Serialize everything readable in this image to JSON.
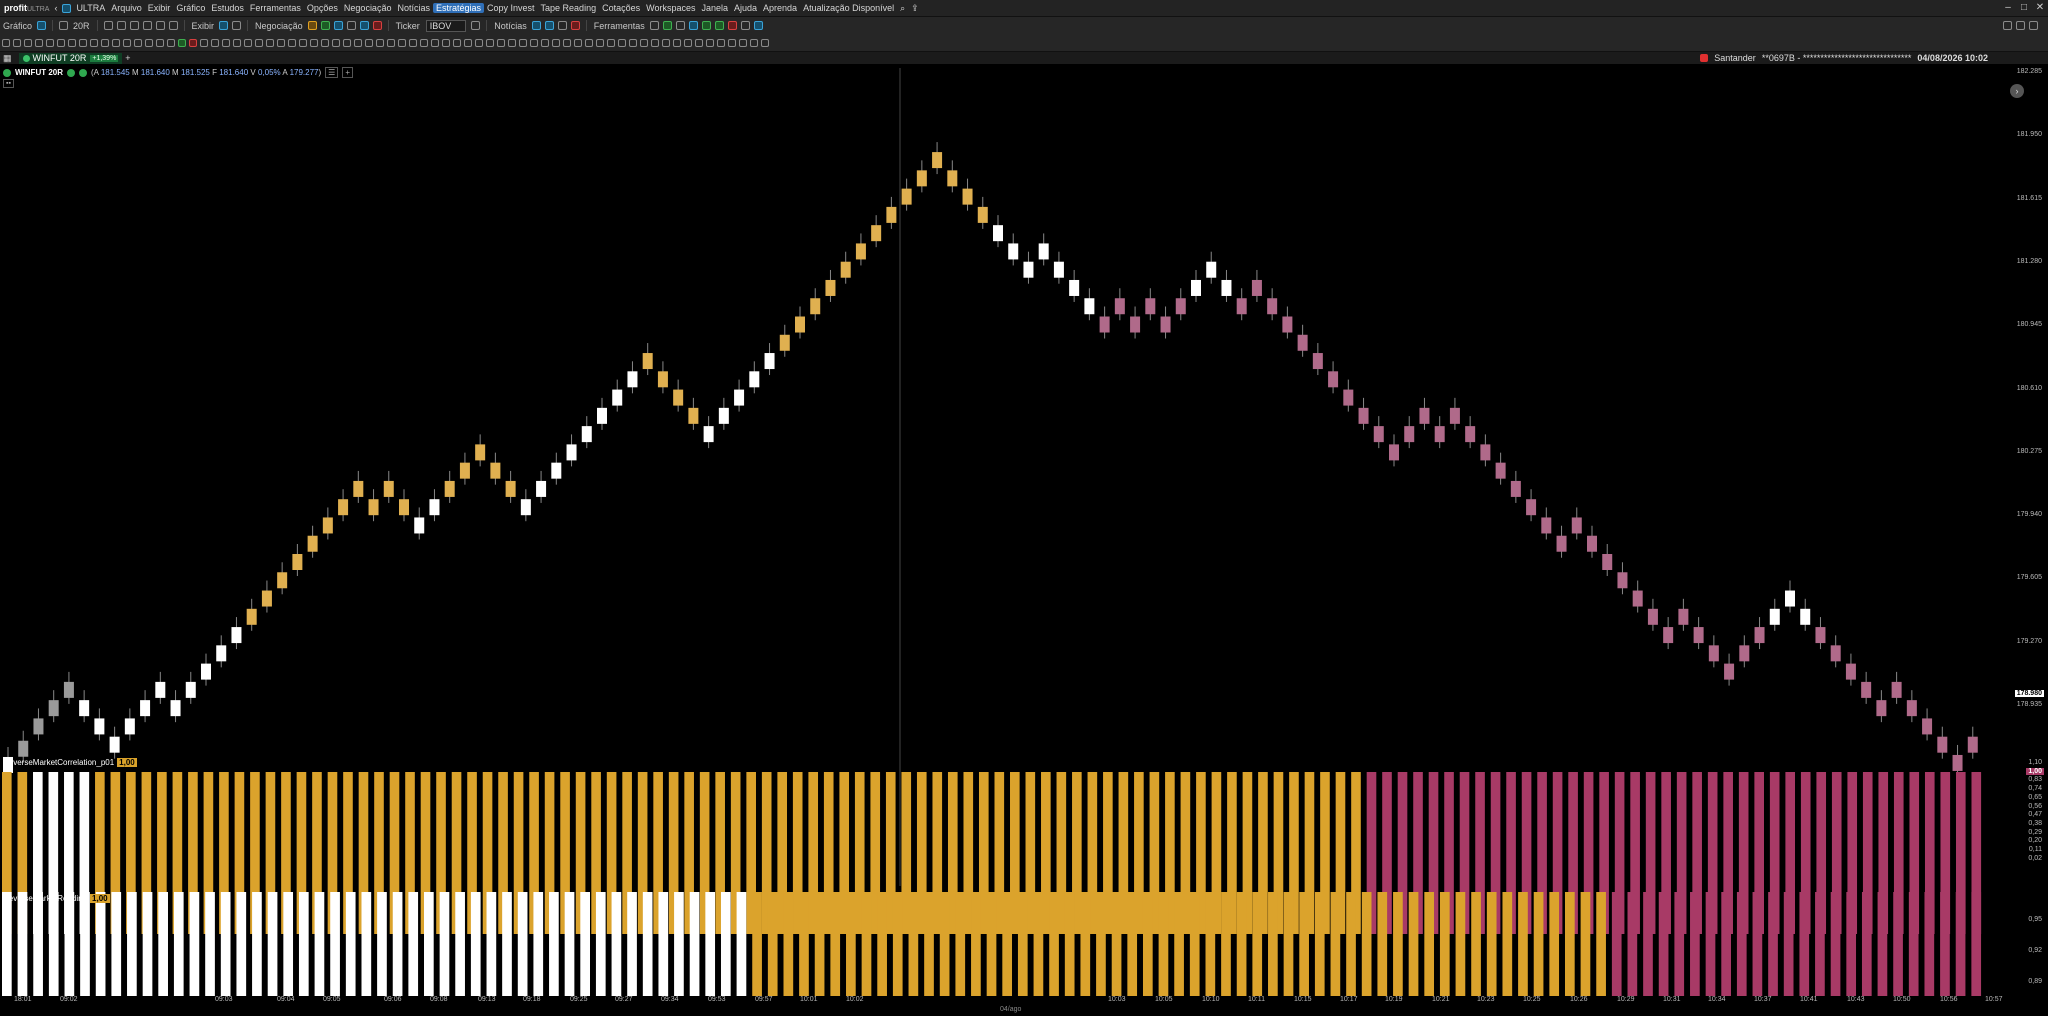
{
  "app": {
    "name": "profit",
    "edition": "ULTRA",
    "badge": "ULTRA"
  },
  "menu": [
    "Arquivo",
    "Exibir",
    "Gráfico",
    "Estudos",
    "Ferramentas",
    "Opções",
    "Negociação",
    "Notícias",
    "Estratégias",
    "Copy Invest",
    "Tape Reading",
    "Cotações",
    "Workspaces",
    "Janela",
    "Ajuda",
    "Aprenda",
    "Atualização Disponível"
  ],
  "menu_active": "Estratégias",
  "toolbar": {
    "grafico": "Gráfico",
    "timeframe": "20R",
    "exibir": "Exibir",
    "negociacao": "Negociação",
    "ticker": "Ticker",
    "ticker_value": "IBOV",
    "noticias": "Notícias",
    "ferramentas": "Ferramentas"
  },
  "tab": {
    "symbol": "WINFUT 20R",
    "change": "+1,39%"
  },
  "broker": {
    "name": "Santander",
    "account": "**0697B - *******************************",
    "datetime": "04/08/2026 10:02"
  },
  "chart_header": {
    "symbol": "WINFUT 20R",
    "a_label": "A",
    "open": "181.545",
    "m_label": "M",
    "max": "181.640",
    "m2_label": "M",
    "min": "181.525",
    "f_label": "F",
    "close": "181.640",
    "v_label": "V",
    "var": "0,05%",
    "a2_label": "A",
    "prev": "179.277"
  },
  "indicators": {
    "correlation": {
      "name": "ReverseMarketCorrelation_p01",
      "value": "1,00",
      "last": "1,00",
      "scale": [
        "1,10",
        "0,93",
        "0,83",
        "0,74",
        "0,65",
        "0,56",
        "0,47",
        "0,38",
        "0,29",
        "0,20",
        "0,11",
        "0,02"
      ]
    },
    "reading": {
      "name": "ReverseMarketReading",
      "value": "1,00",
      "scale": [
        "0,95",
        "0,92",
        "0,89"
      ]
    }
  },
  "price_axis": [
    "182.285",
    "181.950",
    "181.615",
    "181.280",
    "180.945",
    "180.610",
    "180.275",
    "179.940",
    "179.605",
    "179.270",
    "178.935"
  ],
  "last_price": "178.980",
  "time_labels": [
    "18:01",
    "09:02",
    "09:03",
    "09:04",
    "09:05",
    "09:06",
    "09:08",
    "09:13",
    "09:18",
    "09:25",
    "09:27",
    "09:34",
    "09:53",
    "09:57",
    "10:01",
    "10:02",
    "10:03",
    "10:05",
    "10:10",
    "10:11",
    "10:15",
    "10:17",
    "10:19",
    "10:21",
    "10:23",
    "10:25",
    "10:26",
    "10:29",
    "10:31",
    "10:34",
    "10:37",
    "10:41",
    "10:43",
    "10:50",
    "10:56",
    "10:57"
  ],
  "date_label": "04/ago",
  "colors": {
    "gold": "#e0b050",
    "white": "#ffffff",
    "gray": "#9a9a9a",
    "pink": "#b06a8a",
    "bar_gold": "#dba32c",
    "bar_pink": "#a83a66"
  },
  "chart_data": {
    "type": "candlestick",
    "ylim": [
      178.935,
      182.285
    ],
    "candles": [
      {
        "c": "white",
        "p": 178.94
      },
      {
        "c": "gray",
        "p": 179.02
      },
      {
        "c": "gray",
        "p": 179.13
      },
      {
        "c": "gray",
        "p": 179.22
      },
      {
        "c": "gray",
        "p": 179.31
      },
      {
        "c": "white",
        "p": 179.22
      },
      {
        "c": "white",
        "p": 179.13
      },
      {
        "c": "white",
        "p": 179.04
      },
      {
        "c": "white",
        "p": 179.13
      },
      {
        "c": "white",
        "p": 179.22
      },
      {
        "c": "white",
        "p": 179.31
      },
      {
        "c": "white",
        "p": 179.22
      },
      {
        "c": "white",
        "p": 179.31
      },
      {
        "c": "white",
        "p": 179.4
      },
      {
        "c": "white",
        "p": 179.49
      },
      {
        "c": "white",
        "p": 179.58
      },
      {
        "c": "gold",
        "p": 179.67
      },
      {
        "c": "gold",
        "p": 179.76
      },
      {
        "c": "gold",
        "p": 179.85
      },
      {
        "c": "gold",
        "p": 179.94
      },
      {
        "c": "gold",
        "p": 180.03
      },
      {
        "c": "gold",
        "p": 180.12
      },
      {
        "c": "gold",
        "p": 180.21
      },
      {
        "c": "gold",
        "p": 180.3
      },
      {
        "c": "gold",
        "p": 180.21
      },
      {
        "c": "gold",
        "p": 180.3
      },
      {
        "c": "gold",
        "p": 180.21
      },
      {
        "c": "white",
        "p": 180.12
      },
      {
        "c": "white",
        "p": 180.21
      },
      {
        "c": "gold",
        "p": 180.3
      },
      {
        "c": "gold",
        "p": 180.39
      },
      {
        "c": "gold",
        "p": 180.48
      },
      {
        "c": "gold",
        "p": 180.39
      },
      {
        "c": "gold",
        "p": 180.3
      },
      {
        "c": "white",
        "p": 180.21
      },
      {
        "c": "white",
        "p": 180.3
      },
      {
        "c": "white",
        "p": 180.39
      },
      {
        "c": "white",
        "p": 180.48
      },
      {
        "c": "white",
        "p": 180.57
      },
      {
        "c": "white",
        "p": 180.66
      },
      {
        "c": "white",
        "p": 180.75
      },
      {
        "c": "white",
        "p": 180.84
      },
      {
        "c": "gold",
        "p": 180.93
      },
      {
        "c": "gold",
        "p": 180.84
      },
      {
        "c": "gold",
        "p": 180.75
      },
      {
        "c": "gold",
        "p": 180.66
      },
      {
        "c": "white",
        "p": 180.57
      },
      {
        "c": "white",
        "p": 180.66
      },
      {
        "c": "white",
        "p": 180.75
      },
      {
        "c": "white",
        "p": 180.84
      },
      {
        "c": "white",
        "p": 180.93
      },
      {
        "c": "gold",
        "p": 181.02
      },
      {
        "c": "gold",
        "p": 181.11
      },
      {
        "c": "gold",
        "p": 181.2
      },
      {
        "c": "gold",
        "p": 181.29
      },
      {
        "c": "gold",
        "p": 181.38
      },
      {
        "c": "gold",
        "p": 181.47
      },
      {
        "c": "gold",
        "p": 181.56
      },
      {
        "c": "gold",
        "p": 181.65
      },
      {
        "c": "gold",
        "p": 181.74
      },
      {
        "c": "gold",
        "p": 181.83
      },
      {
        "c": "gold",
        "p": 181.92
      },
      {
        "c": "gold",
        "p": 181.83
      },
      {
        "c": "gold",
        "p": 181.74
      },
      {
        "c": "gold",
        "p": 181.65
      },
      {
        "c": "white",
        "p": 181.56
      },
      {
        "c": "white",
        "p": 181.47
      },
      {
        "c": "white",
        "p": 181.38
      },
      {
        "c": "white",
        "p": 181.47
      },
      {
        "c": "white",
        "p": 181.38
      },
      {
        "c": "white",
        "p": 181.29
      },
      {
        "c": "white",
        "p": 181.2
      },
      {
        "c": "pink",
        "p": 181.11
      },
      {
        "c": "pink",
        "p": 181.2
      },
      {
        "c": "pink",
        "p": 181.11
      },
      {
        "c": "pink",
        "p": 181.2
      },
      {
        "c": "pink",
        "p": 181.11
      },
      {
        "c": "pink",
        "p": 181.2
      },
      {
        "c": "white",
        "p": 181.29
      },
      {
        "c": "white",
        "p": 181.38
      },
      {
        "c": "white",
        "p": 181.29
      },
      {
        "c": "pink",
        "p": 181.2
      },
      {
        "c": "pink",
        "p": 181.29
      },
      {
        "c": "pink",
        "p": 181.2
      },
      {
        "c": "pink",
        "p": 181.11
      },
      {
        "c": "pink",
        "p": 181.02
      },
      {
        "c": "pink",
        "p": 180.93
      },
      {
        "c": "pink",
        "p": 180.84
      },
      {
        "c": "pink",
        "p": 180.75
      },
      {
        "c": "pink",
        "p": 180.66
      },
      {
        "c": "pink",
        "p": 180.57
      },
      {
        "c": "pink",
        "p": 180.48
      },
      {
        "c": "pink",
        "p": 180.57
      },
      {
        "c": "pink",
        "p": 180.66
      },
      {
        "c": "pink",
        "p": 180.57
      },
      {
        "c": "pink",
        "p": 180.66
      },
      {
        "c": "pink",
        "p": 180.57
      },
      {
        "c": "pink",
        "p": 180.48
      },
      {
        "c": "pink",
        "p": 180.39
      },
      {
        "c": "pink",
        "p": 180.3
      },
      {
        "c": "pink",
        "p": 180.21
      },
      {
        "c": "pink",
        "p": 180.12
      },
      {
        "c": "pink",
        "p": 180.03
      },
      {
        "c": "pink",
        "p": 180.12
      },
      {
        "c": "pink",
        "p": 180.03
      },
      {
        "c": "pink",
        "p": 179.94
      },
      {
        "c": "pink",
        "p": 179.85
      },
      {
        "c": "pink",
        "p": 179.76
      },
      {
        "c": "pink",
        "p": 179.67
      },
      {
        "c": "pink",
        "p": 179.58
      },
      {
        "c": "pink",
        "p": 179.67
      },
      {
        "c": "pink",
        "p": 179.58
      },
      {
        "c": "pink",
        "p": 179.49
      },
      {
        "c": "pink",
        "p": 179.4
      },
      {
        "c": "pink",
        "p": 179.49
      },
      {
        "c": "pink",
        "p": 179.58
      },
      {
        "c": "white",
        "p": 179.67
      },
      {
        "c": "white",
        "p": 179.76
      },
      {
        "c": "white",
        "p": 179.67
      },
      {
        "c": "pink",
        "p": 179.58
      },
      {
        "c": "pink",
        "p": 179.49
      },
      {
        "c": "pink",
        "p": 179.4
      },
      {
        "c": "pink",
        "p": 179.31
      },
      {
        "c": "pink",
        "p": 179.22
      },
      {
        "c": "pink",
        "p": 179.31
      },
      {
        "c": "pink",
        "p": 179.22
      },
      {
        "c": "pink",
        "p": 179.13
      },
      {
        "c": "pink",
        "p": 179.04
      },
      {
        "c": "pink",
        "p": 178.95
      },
      {
        "c": "pink",
        "p": 179.04
      }
    ],
    "correlation_bars": {
      "colors_sequence": [
        {
          "c": "gold",
          "n": 2
        },
        {
          "c": "white",
          "n": 4
        },
        {
          "c": "gold",
          "n": 82
        },
        {
          "c": "pink",
          "n": 40
        }
      ]
    },
    "reading_bars": {
      "colors_sequence": [
        {
          "c": "white",
          "n": 48
        },
        {
          "c": "gold",
          "n": 55
        },
        {
          "c": "pink",
          "n": 24
        }
      ]
    }
  }
}
